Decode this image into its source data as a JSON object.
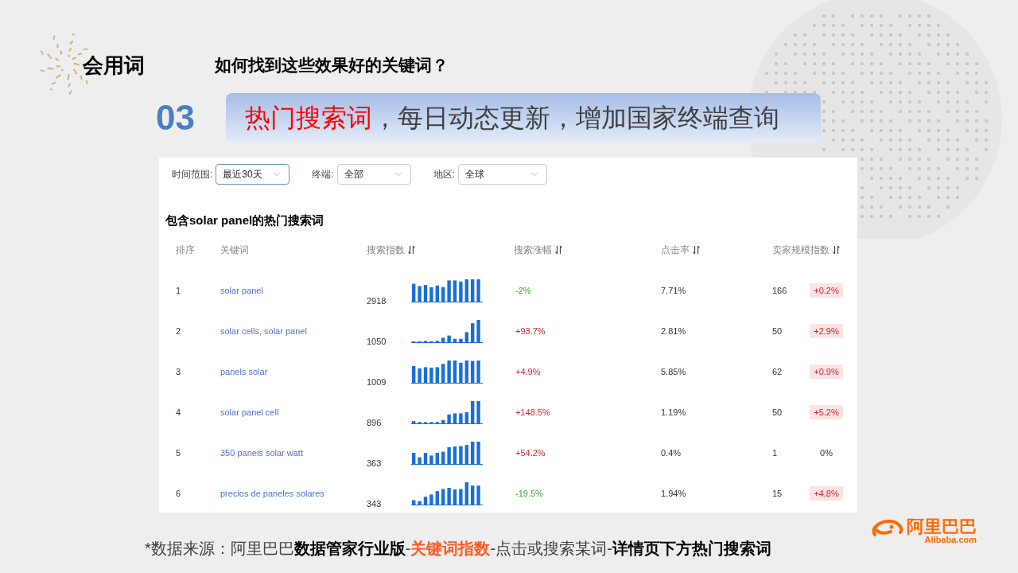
{
  "header": {
    "section": "会用词",
    "question": "如何找到这些效果好的关键词？"
  },
  "step": {
    "number": "03",
    "banner": [
      {
        "text": "热门搜索词",
        "kind": "highlight"
      },
      {
        "text": "，每日动态更新，增加国家终端查询",
        "kind": "plain"
      }
    ]
  },
  "filters": [
    {
      "label": "时间范围:",
      "value": "最近30天",
      "selected": true
    },
    {
      "label": "终端:",
      "value": "全部",
      "selected": false
    },
    {
      "label": "地区:",
      "value": "全球",
      "selected": false
    }
  ],
  "table_title": "包含solar panel的热门搜索词",
  "columns": [
    {
      "label": "排序",
      "sortable": false
    },
    {
      "label": "关键词",
      "sortable": false
    },
    {
      "label": "搜索指数",
      "sortable": true
    },
    {
      "label": "搜索涨幅",
      "sortable": true
    },
    {
      "label": "点击率",
      "sortable": true
    },
    {
      "label": "卖家规模指数",
      "sortable": true
    }
  ],
  "rows": [
    {
      "rank": "1",
      "keyword": "solar panel",
      "index": "2918",
      "growth": "-2%",
      "growth_rising": false,
      "ctr": "7.71%",
      "sellers": "166",
      "seller_change": "+0.2%",
      "seller_highlighted": true
    },
    {
      "rank": "2",
      "keyword": "solar cells, solar panel",
      "index": "1050",
      "growth": "+93.7%",
      "growth_rising": true,
      "ctr": "2.81%",
      "sellers": "50",
      "seller_change": "+2.9%",
      "seller_highlighted": true
    },
    {
      "rank": "3",
      "keyword": "panels solar",
      "index": "1009",
      "growth": "+4.9%",
      "growth_rising": true,
      "ctr": "5.85%",
      "sellers": "62",
      "seller_change": "+0.9%",
      "seller_highlighted": true
    },
    {
      "rank": "4",
      "keyword": "solar panel cell",
      "index": "896",
      "growth": "+148.5%",
      "growth_rising": true,
      "ctr": "1.19%",
      "sellers": "50",
      "seller_change": "+5.2%",
      "seller_highlighted": true
    },
    {
      "rank": "5",
      "keyword": "350 panels solar watt",
      "index": "363",
      "growth": "+54.2%",
      "growth_rising": true,
      "ctr": "0.4%",
      "sellers": "1",
      "seller_change": "0%",
      "seller_highlighted": false
    },
    {
      "rank": "6",
      "keyword": "precios de paneles solares",
      "index": "343",
      "growth": "-19.5%",
      "growth_rising": false,
      "ctr": "1.94%",
      "sellers": "15",
      "seller_change": "+4.8%",
      "seller_highlighted": true
    }
  ],
  "footer": [
    {
      "text": "*数据来源：阿里巴巴",
      "kind": "plain"
    },
    {
      "text": "数据管家行业版",
      "kind": "bold"
    },
    {
      "text": "-",
      "kind": "plain"
    },
    {
      "text": "关键词指数",
      "kind": "highlight"
    },
    {
      "text": "-点击或搜索某词-",
      "kind": "plain"
    },
    {
      "text": "详情页下方热门搜索词",
      "kind": "bold"
    }
  ],
  "logo": {
    "name": "阿里巴巴",
    "domain": "Alibaba.com"
  }
}
